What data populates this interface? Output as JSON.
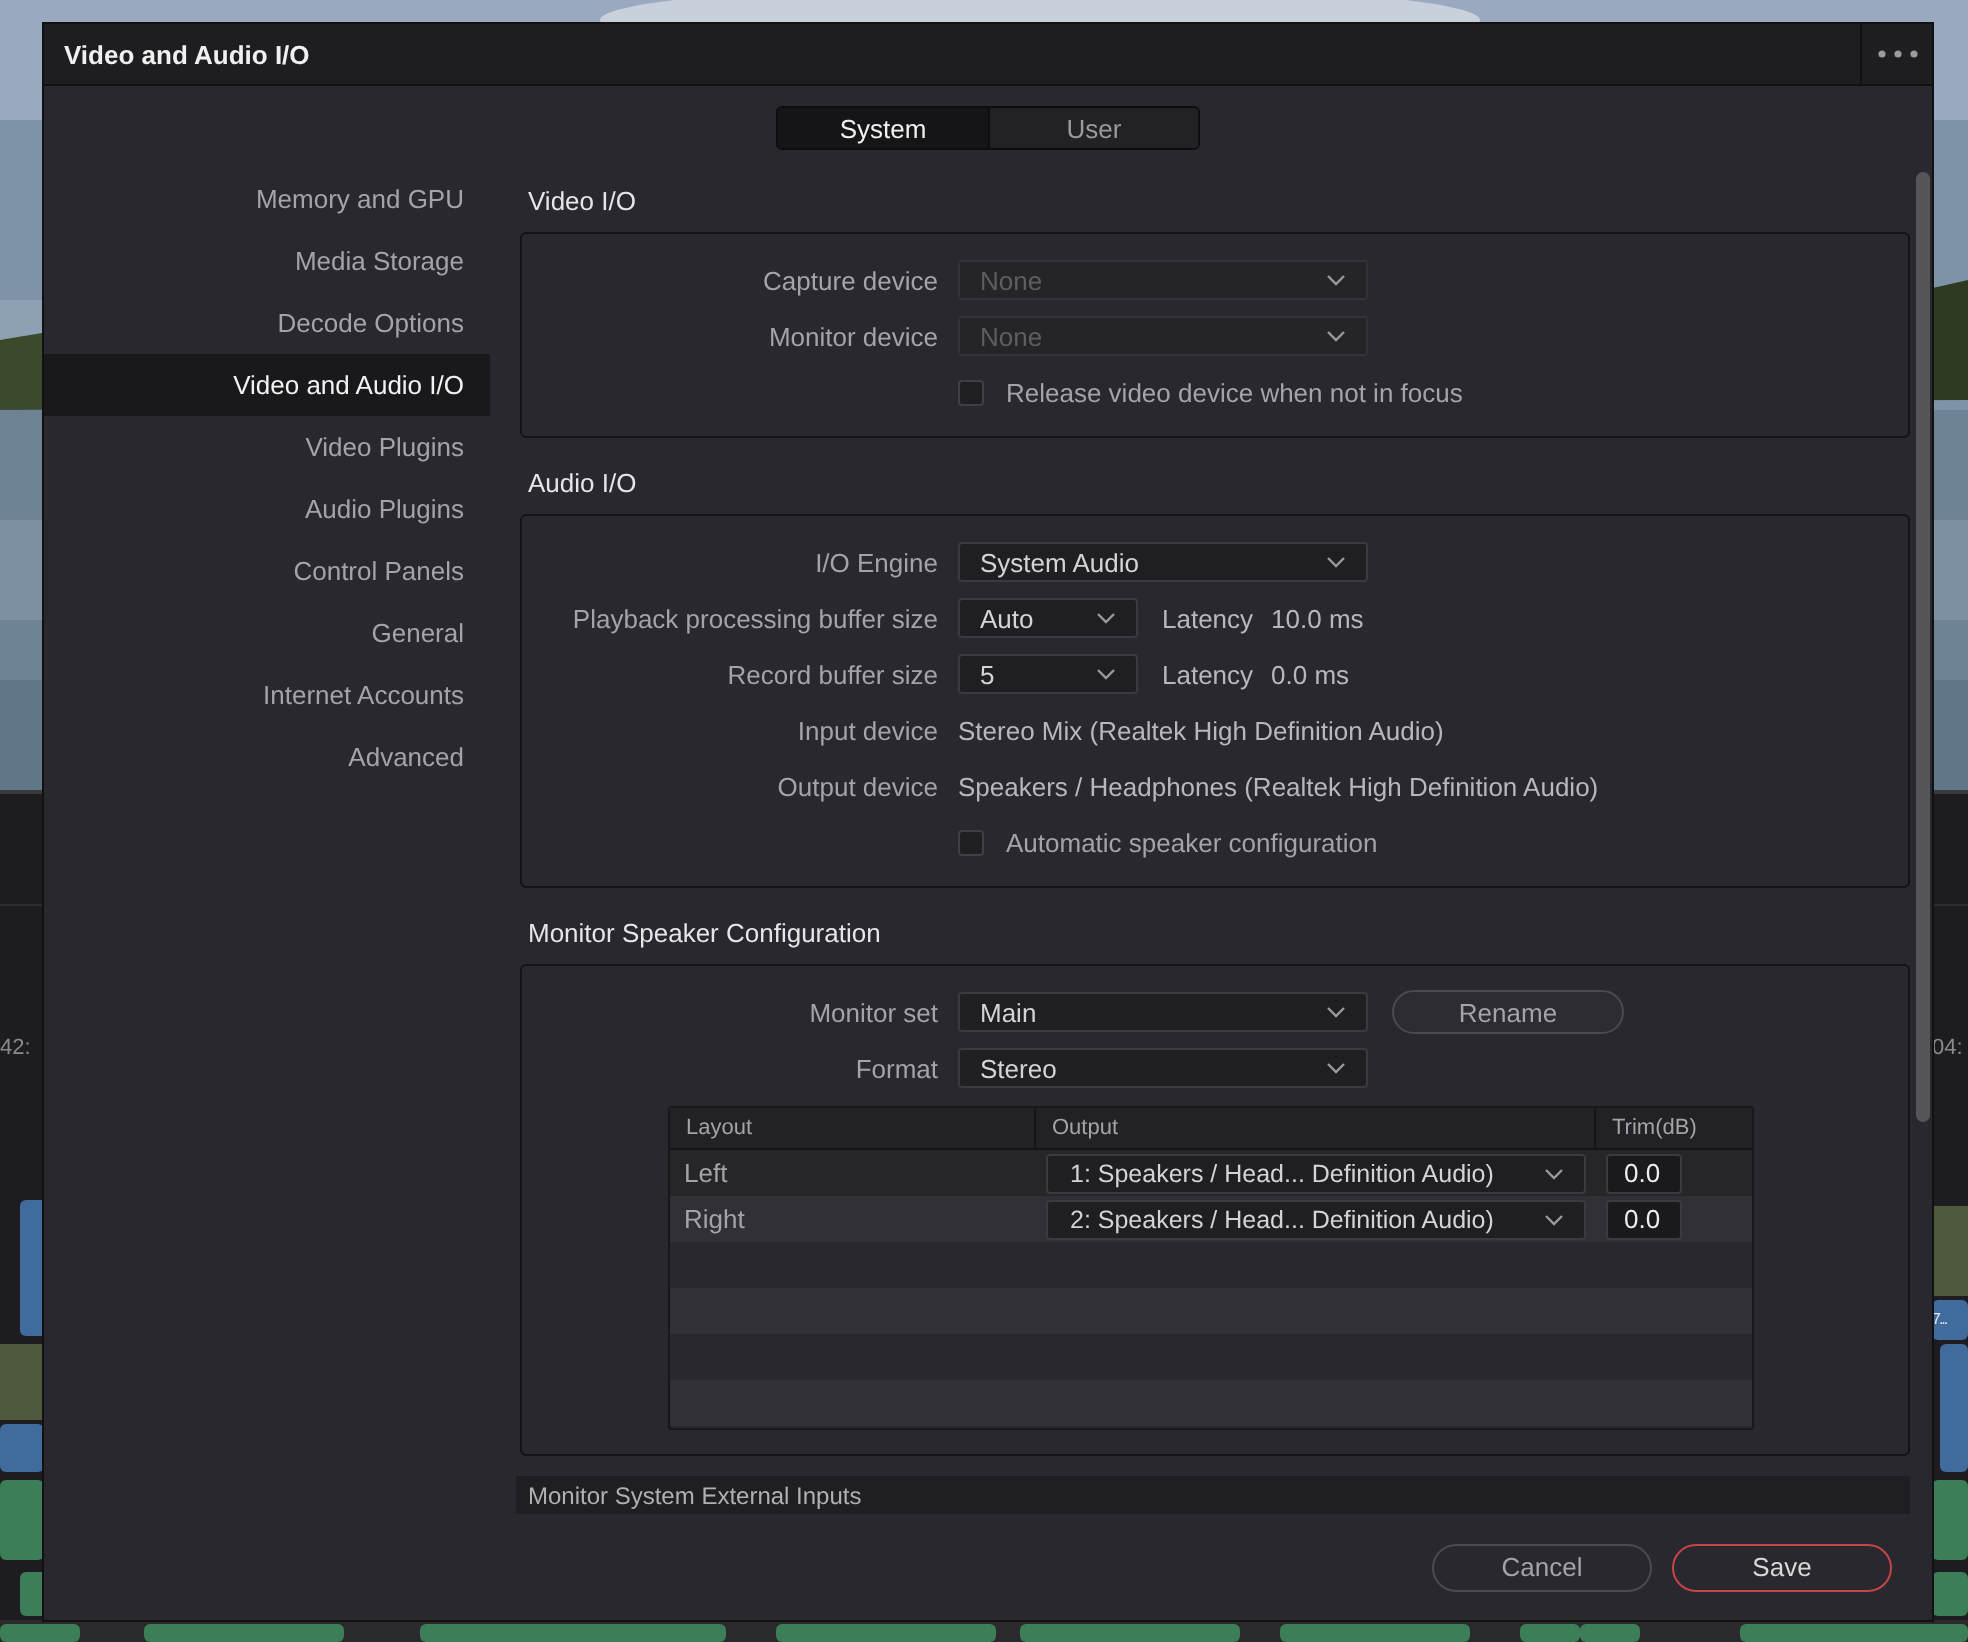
{
  "background": {
    "timecodes": [
      "42:",
      "04:"
    ],
    "clip_label": "7..."
  },
  "window": {
    "title": "Video and Audio I/O"
  },
  "tabs": [
    {
      "label": "System",
      "selected": true
    },
    {
      "label": "User",
      "selected": false
    }
  ],
  "sidebar": {
    "items": [
      {
        "label": "Memory and GPU",
        "selected": false
      },
      {
        "label": "Media Storage",
        "selected": false
      },
      {
        "label": "Decode Options",
        "selected": false
      },
      {
        "label": "Video and Audio I/O",
        "selected": true
      },
      {
        "label": "Video Plugins",
        "selected": false
      },
      {
        "label": "Audio Plugins",
        "selected": false
      },
      {
        "label": "Control Panels",
        "selected": false
      },
      {
        "label": "General",
        "selected": false
      },
      {
        "label": "Internet Accounts",
        "selected": false
      },
      {
        "label": "Advanced",
        "selected": false
      }
    ]
  },
  "sections": [
    {
      "title": "Video I/O",
      "rows": [
        {
          "kind": "dropdown",
          "label": "Capture device",
          "value": "None",
          "disabled": true
        },
        {
          "kind": "dropdown",
          "label": "Monitor device",
          "value": "None",
          "disabled": true
        },
        {
          "kind": "checkbox",
          "label": "Release video device when not in focus",
          "checked": false
        }
      ]
    },
    {
      "title": "Audio I/O",
      "rows": [
        {
          "kind": "dropdown",
          "label": "I/O Engine",
          "value": "System Audio",
          "disabled": false
        },
        {
          "kind": "latency",
          "label": "Playback processing buffer size",
          "value": "Auto",
          "latency_label": "Latency",
          "latency_value": "10.0 ms"
        },
        {
          "kind": "latency",
          "label": "Record buffer size",
          "value": "5",
          "latency_label": "Latency",
          "latency_value": "0.0 ms"
        },
        {
          "kind": "info",
          "label": "Input device",
          "value": "Stereo Mix (Realtek High Definition Audio)"
        },
        {
          "kind": "info",
          "label": "Output device",
          "value": "Speakers / Headphones (Realtek High Definition Audio)"
        },
        {
          "kind": "checkbox",
          "label": "Automatic speaker configuration",
          "checked": false
        }
      ]
    },
    {
      "title": "Monitor Speaker Configuration",
      "rows": [
        {
          "kind": "dropdown",
          "label": "Monitor set",
          "value": "Main",
          "disabled": false,
          "button": "Rename"
        },
        {
          "kind": "dropdown",
          "label": "Format",
          "value": "Stereo",
          "disabled": false
        },
        {
          "kind": "table",
          "columns": [
            "Layout",
            "Output",
            "Trim(dB)"
          ],
          "rows": [
            {
              "layout": "Left",
              "output": "1: Speakers / Head... Definition Audio)",
              "trim": "0.0"
            },
            {
              "layout": "Right",
              "output": "2: Speakers / Head... Definition Audio)",
              "trim": "0.0"
            }
          ]
        }
      ]
    },
    {
      "title": "Monitor System External Inputs"
    }
  ],
  "buttons": [
    {
      "label": "Cancel",
      "kind": "secondary"
    },
    {
      "label": "Save",
      "kind": "primary"
    }
  ]
}
